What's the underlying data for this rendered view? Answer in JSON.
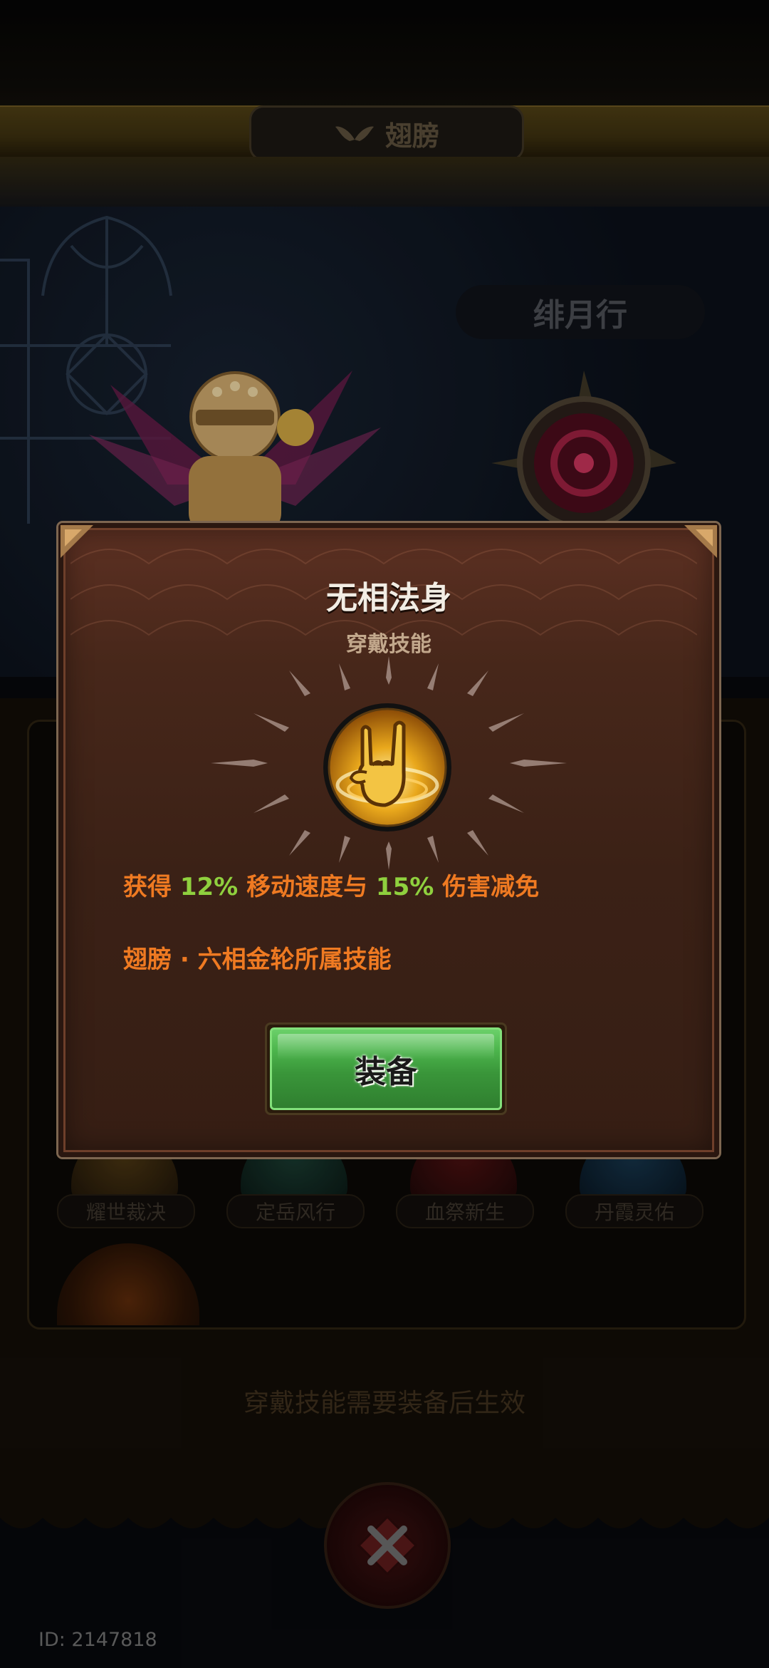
{
  "header": {
    "title": "翅膀",
    "icon": "wings-icon"
  },
  "character": {
    "name": "绯月行"
  },
  "skills_bg": [
    {
      "label": "耀世裁决"
    },
    {
      "label": "定岳风行"
    },
    {
      "label": "血祭新生"
    },
    {
      "label": "丹霞灵佑"
    }
  ],
  "hint": "穿戴技能需要装备后生效",
  "footer": {
    "id_text": "ID: 2147818"
  },
  "modal": {
    "title": "无相法身",
    "subtitle": "穿戴技能",
    "skill_icon": "rock-hand-icon",
    "desc": {
      "prefix": "获得 ",
      "value1": "12%",
      "mid": " 移动速度与 ",
      "value2": "15%",
      "suffix": " 伤害减免"
    },
    "source": "翅膀 · 六相金轮所属技能",
    "equip_label": "装备"
  },
  "colors": {
    "accent_orange": "#ef7a22",
    "highlight_green": "#8fd03e",
    "button_green": "#4bb34b",
    "modal_bg": "#47271a"
  }
}
